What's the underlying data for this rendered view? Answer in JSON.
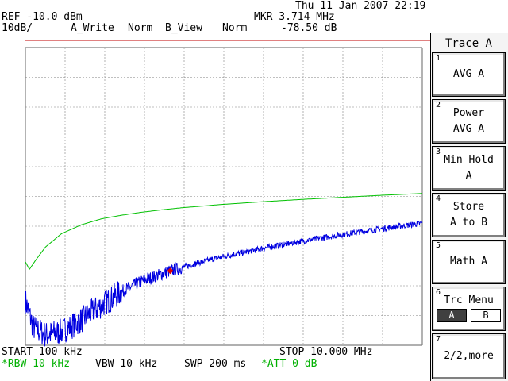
{
  "status": {
    "datetime": "Thu 11 Jan 2007 22:19",
    "ref": "REF -10.0 dBm",
    "mkr_freq": "MKR 3.714 MHz",
    "scale": "10dB/",
    "trace_a_mode": "A_Write",
    "trace_a_det": "Norm",
    "trace_b_mode": "B_View",
    "trace_b_det": "Norm",
    "mkr_level": "-78.50 dB"
  },
  "footer": {
    "start": "START 100 kHz",
    "stop": "STOP 10.000 MHz",
    "rbw": "*RBW 10 kHz",
    "vbw": "VBW 10 kHz",
    "swp": "SWP 200 ms",
    "att": "*ATT 0 dB"
  },
  "menu": {
    "title": "Trace A",
    "keys": [
      {
        "num": "1",
        "line1": "AVG A",
        "line2": ""
      },
      {
        "num": "2",
        "line1": "Power",
        "line2": "AVG A"
      },
      {
        "num": "3",
        "line1": "Min Hold",
        "line2": "A"
      },
      {
        "num": "4",
        "line1": "Store",
        "line2": "A to B"
      },
      {
        "num": "5",
        "line1": "Math A",
        "line2": ""
      },
      {
        "num": "6",
        "line1": "Trc Menu",
        "line2": "",
        "opt_a": "A",
        "opt_b": "B"
      },
      {
        "num": "7",
        "line1": "2/2,more",
        "line2": ""
      }
    ]
  },
  "colors": {
    "grid": "#808080",
    "ref_line": "#c00000",
    "trace_green": "#00c000",
    "trace_blue": "#0000e0",
    "marker": "#e00000",
    "footer_highlight": "#00b000"
  },
  "chart_data": {
    "type": "line",
    "x_range_mhz": [
      0.1,
      10.0
    ],
    "y_range_db": [
      -110,
      -10
    ],
    "grid": true,
    "series": [
      {
        "color_key": "trace_green",
        "x": [
          0.1,
          0.2,
          0.35,
          0.6,
          1.0,
          1.5,
          2.0,
          2.5,
          3.0,
          3.5,
          4.0,
          5.0,
          6.0,
          7.0,
          8.0,
          9.0,
          10.0
        ],
        "y": [
          -82.0,
          -84.5,
          -81.5,
          -77.0,
          -72.5,
          -69.5,
          -67.5,
          -66.3,
          -65.3,
          -64.5,
          -63.8,
          -62.7,
          -61.8,
          -61.0,
          -60.3,
          -59.6,
          -59.0
        ]
      },
      {
        "color_key": "trace_blue",
        "noisy": true,
        "x": [
          0.1,
          0.3,
          0.6,
          1.0,
          1.5,
          2.0,
          2.5,
          3.0,
          3.714,
          4.5,
          5.0,
          6.0,
          7.0,
          8.0,
          9.0,
          10.0
        ],
        "y": [
          -95.0,
          -104.0,
          -106.5,
          -105.5,
          -101.5,
          -96.5,
          -92.0,
          -88.5,
          -85.0,
          -82.0,
          -80.3,
          -77.5,
          -75.0,
          -72.8,
          -70.8,
          -69.0
        ]
      }
    ],
    "marker": {
      "x": 3.714,
      "y": -85.0
    }
  }
}
